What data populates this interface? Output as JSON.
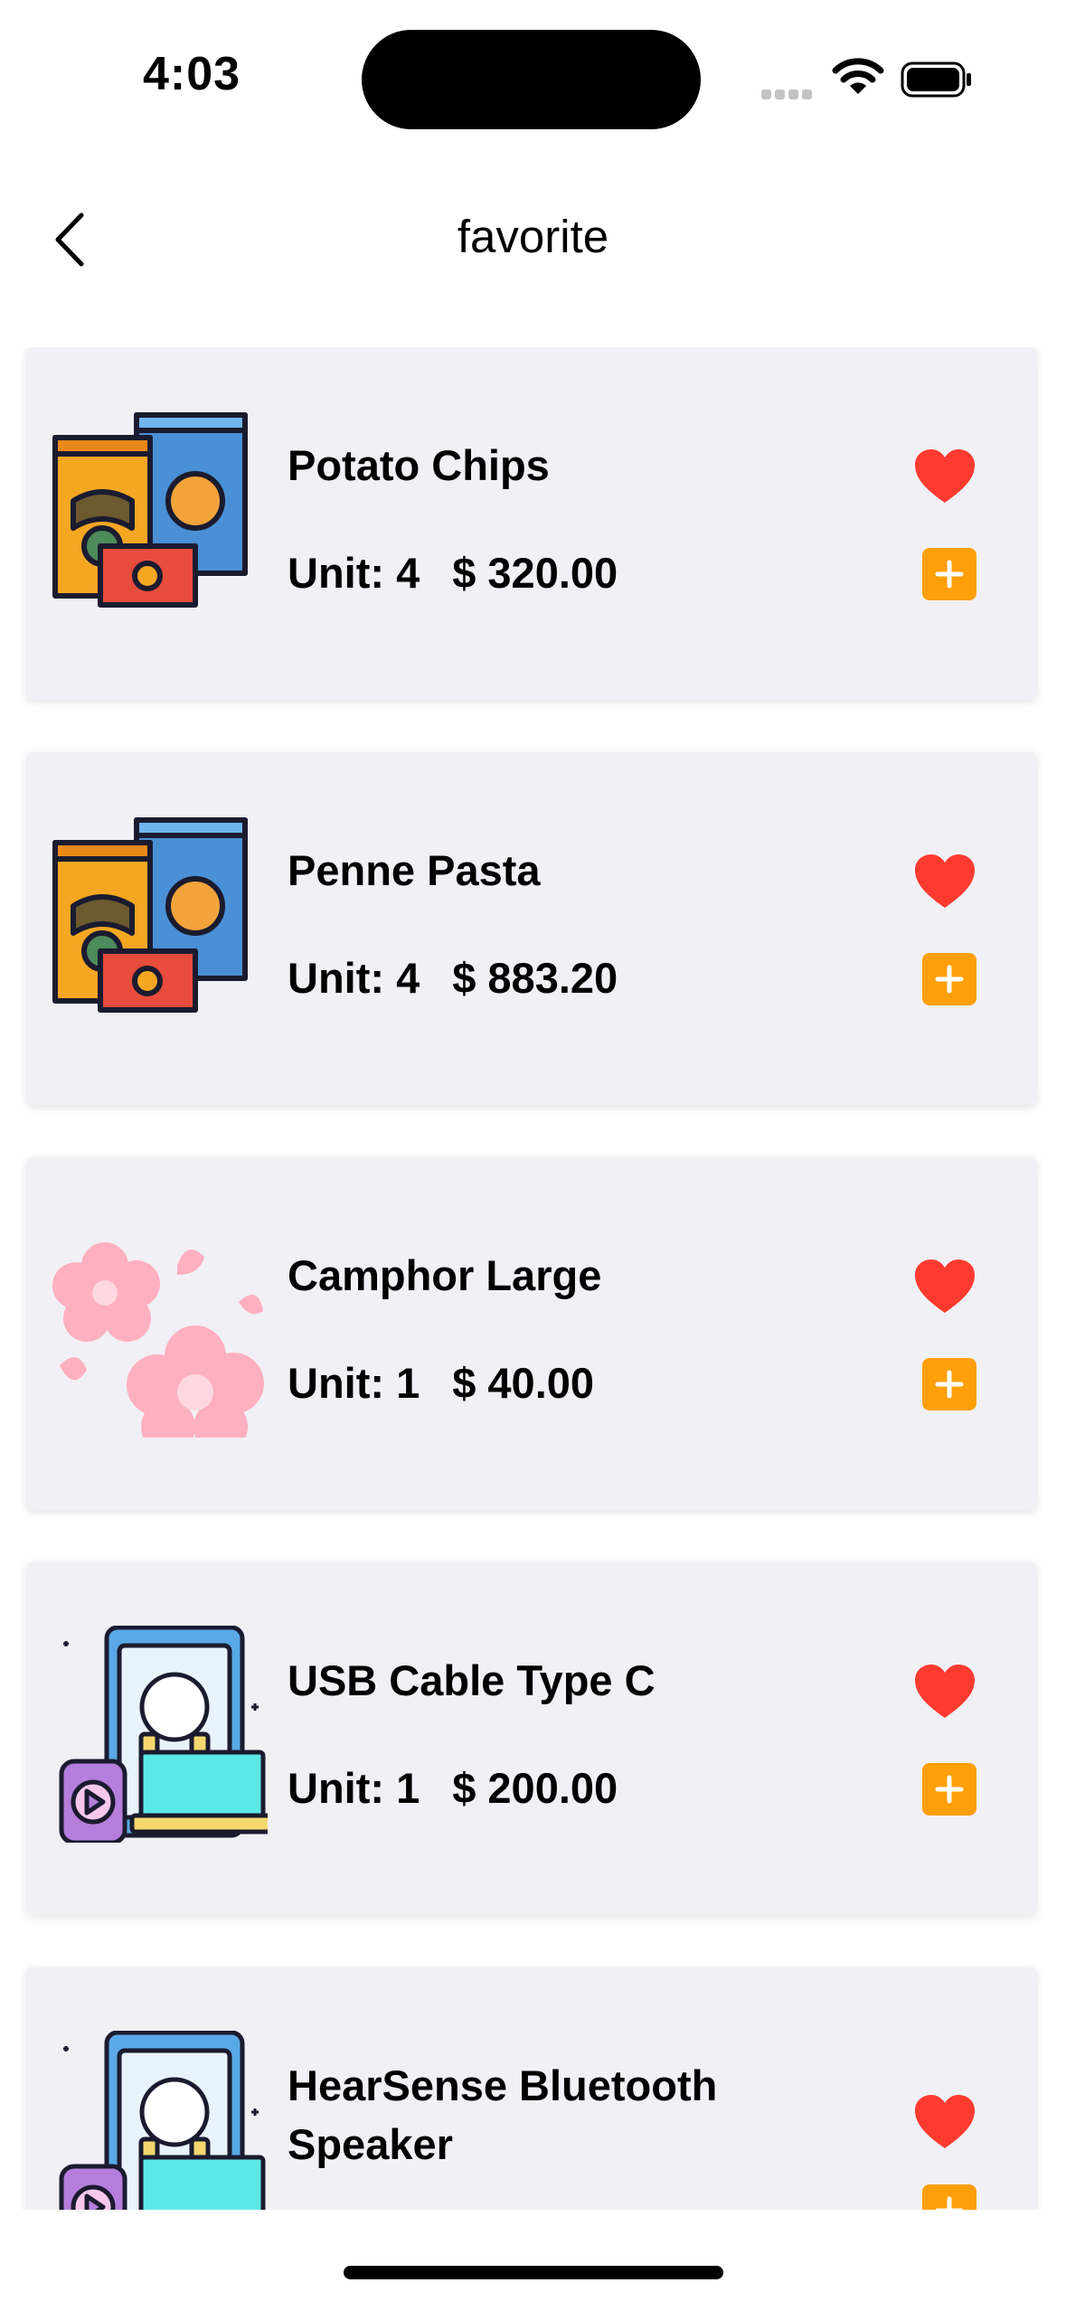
{
  "status": {
    "time": "4:03"
  },
  "header": {
    "title": "favorite"
  },
  "colors": {
    "heart": "#ff3b30",
    "add": "#ff9f0a",
    "card_bg": "#f1f0f5"
  },
  "items": [
    {
      "name": "Potato Chips",
      "unit": "Unit: 4",
      "price": "$ 320.00",
      "icon": "snack-bags-icon"
    },
    {
      "name": "Penne Pasta",
      "unit": "Unit: 4",
      "price": "$ 883.20",
      "icon": "snack-bags-icon"
    },
    {
      "name": "Camphor Large",
      "unit": "Unit: 1",
      "price": "$ 40.00",
      "icon": "flowers-icon"
    },
    {
      "name": "USB Cable Type C",
      "unit": "Unit: 1",
      "price": "$ 200.00",
      "icon": "electronics-icon"
    },
    {
      "name": "HearSense Bluetooth Speaker",
      "unit": "",
      "price": "",
      "icon": "electronics-icon"
    }
  ]
}
